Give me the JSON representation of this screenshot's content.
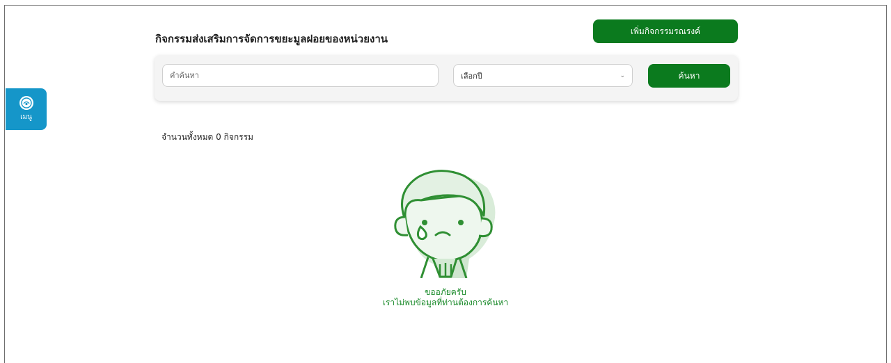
{
  "side_menu": {
    "label": "เมนู",
    "icon": "logo-icon"
  },
  "header": {
    "title": "กิจกรรมส่งเสริมการจัดการขยะมูลฝอยของหน่วยงาน",
    "add_button_label": "เพิ่มกิจกรรมรณรงค์"
  },
  "search": {
    "placeholder": "คำค้นหา",
    "value": "",
    "year_select": {
      "selected": "เลือกปี"
    },
    "search_button_label": "ค้นหา"
  },
  "results": {
    "count_text": "จำนวนทั้งหมด 0 กิจกรรม"
  },
  "empty_state": {
    "line1": "ขออภัยครับ",
    "line2": "เราไม่พบข้อมูลที่ท่านต้องการค้นหา",
    "illustration": "sad-person-illustration"
  },
  "colors": {
    "primary_green": "#0b7a1e",
    "menu_blue": "#1596c9",
    "empty_text_green": "#1a8a2a"
  }
}
